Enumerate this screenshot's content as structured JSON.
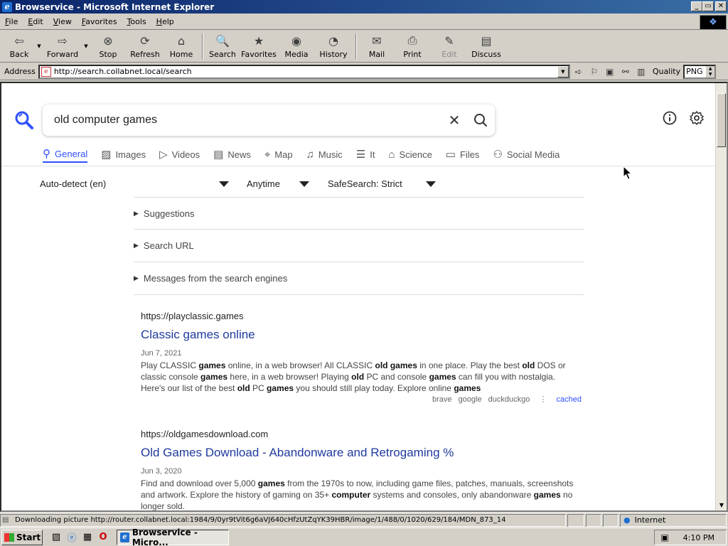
{
  "window": {
    "title": "Browservice - Microsoft Internet Explorer",
    "minimize": "_",
    "restore": "▭",
    "close": "✕"
  },
  "menu": [
    "File",
    "Edit",
    "View",
    "Favorites",
    "Tools",
    "Help"
  ],
  "toolbar": {
    "back": "Back",
    "forward": "Forward",
    "stop": "Stop",
    "refresh": "Refresh",
    "home": "Home",
    "search": "Search",
    "favorites": "Favorites",
    "media": "Media",
    "history": "History",
    "mail": "Mail",
    "print": "Print",
    "edit": "Edit",
    "discuss": "Discuss"
  },
  "address": {
    "label": "Address",
    "url": "http://search.collabnet.local/search",
    "quality_label": "Quality",
    "quality_value": "PNG"
  },
  "search": {
    "query": "old computer games",
    "categories": [
      "General",
      "Images",
      "Videos",
      "News",
      "Map",
      "Music",
      "It",
      "Science",
      "Files",
      "Social Media"
    ],
    "active_category": "General"
  },
  "filters": {
    "language": "Auto-detect (en)",
    "time": "Anytime",
    "safesearch": "SafeSearch: Strict"
  },
  "collapsers": [
    "Suggestions",
    "Search URL",
    "Messages from the search engines"
  ],
  "results": [
    {
      "url": "https://playclassic.games",
      "title": "Classic games online",
      "date": "Jun 7, 2021",
      "snippet_html": "Play CLASSIC <b>games</b> online, in a web browser! All CLASSIC <b>old games</b> in one place. Play the best <b>old</b> DOS or classic console <b>games</b> here, in a web browser! Playing <b>old</b> PC and console <b>games</b> can fill you with nostalgia. Here's our list of the best <b>old</b> PC <b>games</b> you should still play today. Explore online <b>games</b>",
      "engines": [
        "brave",
        "google",
        "duckduckgo"
      ],
      "cached": "cached"
    },
    {
      "url": "https://oldgamesdownload.com",
      "title": "Old Games Download - Abandonware and Retrogaming %",
      "date": "Jun 3, 2020",
      "snippet_html": "Find and download over 5,000 <b>games</b> from the 1970s to now, including game files, patches, manuals, screenshots and artwork. Explore the history of gaming on 35+ <b>computer</b> systems and consoles, only abandonware <b>games</b> no longer sold."
    }
  ],
  "status": {
    "message": "Downloading picture http://router.collabnet.local:1984/9/0yr9tVit6g6aVJ640cHfzUtZqYK39HBR/image/1/488/0/1020/629/184/MDN_873_14",
    "zone": "Internet"
  },
  "taskbar": {
    "start": "Start",
    "task": "Browservice - Micro...",
    "clock": "4:10 PM"
  },
  "colors": {
    "accent": "#3050ff",
    "title_link": "#1f3a9e",
    "titlebar": "#0a246a"
  }
}
